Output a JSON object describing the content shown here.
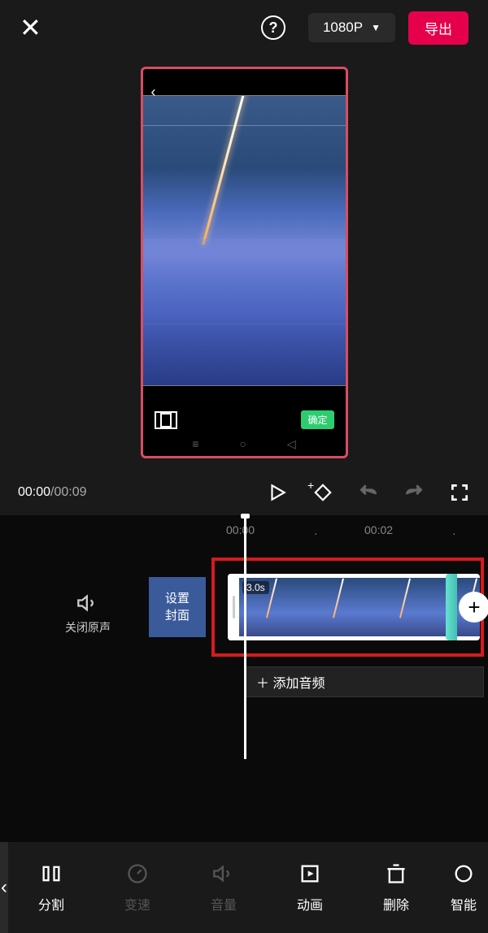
{
  "header": {
    "resolution": "1080P",
    "export_label": "导出"
  },
  "preview": {
    "confirm_label": "确定"
  },
  "playback": {
    "current_time": "00:00",
    "total_time": "00:09"
  },
  "ruler": {
    "marks": [
      "00:00",
      "00:02"
    ]
  },
  "timeline": {
    "mute_label": "关闭原声",
    "cover_label": "设置\n封面",
    "clip_duration": "3.0s",
    "add_audio_label": "＋ 添加音频"
  },
  "tools": {
    "back": "‹",
    "items": [
      {
        "label": "分割",
        "dim": false
      },
      {
        "label": "变速",
        "dim": true
      },
      {
        "label": "音量",
        "dim": true
      },
      {
        "label": "动画",
        "dim": false
      },
      {
        "label": "删除",
        "dim": false
      },
      {
        "label": "智能",
        "dim": false
      }
    ]
  }
}
